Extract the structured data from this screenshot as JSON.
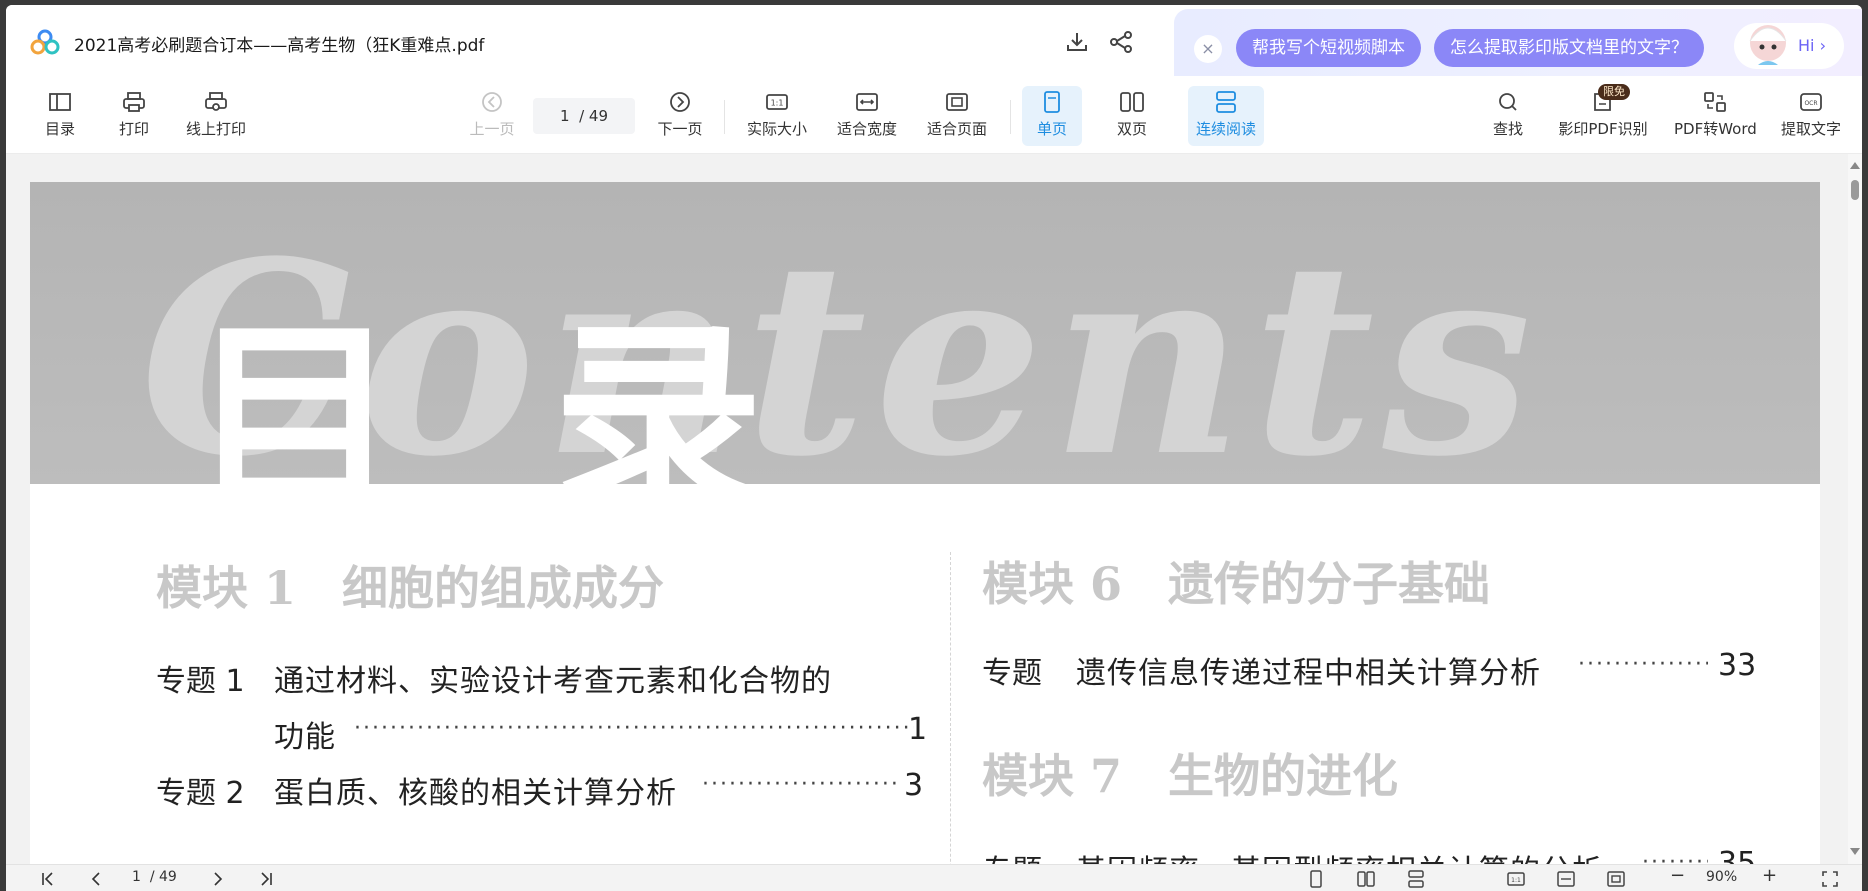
{
  "window": {
    "doc_title": "2021高考必刷题合订本——高考生物（狂K重难点.pdf"
  },
  "ai_panel": {
    "chips": [
      "帮我写个短视频脚本",
      "怎么提取影印版文档里的文字？"
    ],
    "hi_label": "Hi",
    "close_symbol": "×",
    "arrow_symbol": "›"
  },
  "toolbar": {
    "toc": "目录",
    "print": "打印",
    "online_print": "线上打印",
    "prev_page": "上一页",
    "page_current": "1",
    "page_total": "/ 49",
    "next_page": "下一页",
    "actual_size": "实际大小",
    "fit_width": "适合宽度",
    "fit_page": "适合页面",
    "single_page": "单页",
    "double_page": "双页",
    "continuous": "连续阅读",
    "find": "查找",
    "ocr_pdf": "影印PDF识别",
    "ocr_badge": "限免",
    "pdf_to_word": "PDF转Word",
    "extract_text": "提取文字"
  },
  "document": {
    "banner_title": "目 录",
    "banner_watermark": "Contents",
    "left_column": {
      "module_heading": "模块 1　细胞的组成成分",
      "topics": [
        {
          "label": "专题 1",
          "text_line1": "通过材料、实验设计考查元素和化合物的",
          "text_line2": "功能",
          "page": "1"
        },
        {
          "label": "专题 2",
          "text_line1": "蛋白质、核酸的相关计算分析",
          "page": "3"
        }
      ]
    },
    "right_column": {
      "module6_heading": "模块 6　遗传的分子基础",
      "module6_topic": {
        "label": "专题",
        "text": "遗传信息传递过程中相关计算分析",
        "page": "33"
      },
      "module7_heading": "模块 7　生物的进化",
      "module7_topic": {
        "label": "专题",
        "text": "基因频率、基因型频率相关计算的分析",
        "page": "35"
      }
    }
  },
  "statusbar": {
    "page_current": "1",
    "page_total": "/ 49",
    "zoom": "90%",
    "zoom_out": "−",
    "zoom_in": "+"
  },
  "colors": {
    "accent_blue": "#1e8de0",
    "ai_chip": "#8b87f7",
    "banner_gray": "#b8b8b8"
  },
  "icons": [
    "app-logo-icon",
    "download-icon",
    "share-icon",
    "toc-icon",
    "print-icon",
    "online-print-icon",
    "prev-page-icon",
    "next-page-icon",
    "actual-size-icon",
    "fit-width-icon",
    "fit-page-icon",
    "single-page-icon",
    "double-page-icon",
    "continuous-icon",
    "search-icon",
    "ocr-icon",
    "pdf-word-icon",
    "extract-text-icon",
    "first-page-icon",
    "last-page-icon",
    "fullscreen-icon"
  ]
}
